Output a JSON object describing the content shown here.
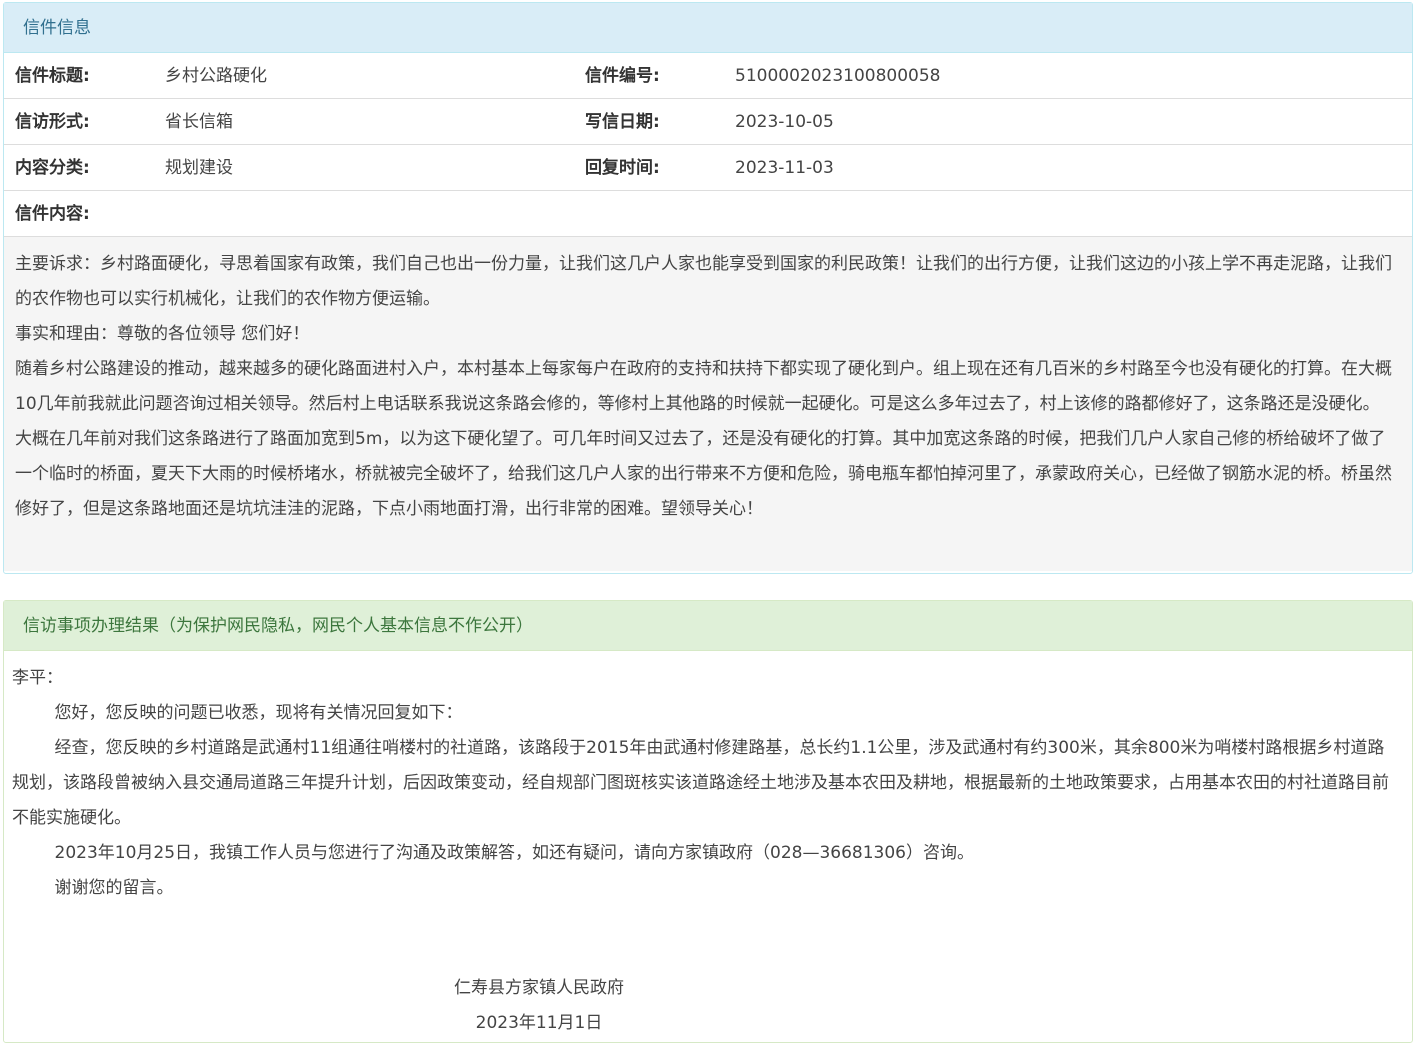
{
  "letter": {
    "heading": "信件信息",
    "rows": [
      {
        "label1": "信件标题:",
        "value1": "乡村公路硬化",
        "label2": "信件编号:",
        "value2": "5100002023100800058"
      },
      {
        "label1": "信访形式:",
        "value1": "省长信箱",
        "label2": "写信日期:",
        "value2": "2023-10-05"
      },
      {
        "label1": "内容分类:",
        "value1": "规划建设",
        "label2": "回复时间:",
        "value2": "2023-11-03"
      }
    ],
    "content_label": "信件内容:",
    "content": [
      "主要诉求：乡村路面硬化，寻思着国家有政策，我们自己也出一份力量，让我们这几户人家也能享受到国家的利民政策！让我们的出行方便，让我们这边的小孩上学不再走泥路，让我们的农作物也可以实行机械化，让我们的农作物方便运输。",
      "事实和理由：尊敬的各位领导 您们好！",
      "随着乡村公路建设的推动，越来越多的硬化路面进村入户，本村基本上每家每户在政府的支持和扶持下都实现了硬化到户。组上现在还有几百米的乡村路至今也没有硬化的打算。在大概10几年前我就此问题咨询过相关领导。然后村上电话联系我说这条路会修的，等修村上其他路的时候就一起硬化。可是这么多年过去了，村上该修的路都修好了，这条路还是没硬化。",
      "大概在几年前对我们这条路进行了路面加宽到5m，以为这下硬化望了。可几年时间又过去了，还是没有硬化的打算。其中加宽这条路的时候，把我们几户人家自己修的桥给破坏了做了一个临时的桥面，夏天下大雨的时候桥堵水，桥就被完全破坏了，给我们这几户人家的出行带来不方便和危险，骑电瓶车都怕掉河里了，承蒙政府关心，已经做了钢筋水泥的桥。桥虽然修好了，但是这条路地面还是坑坑洼洼的泥路，下点小雨地面打滑，出行非常的困难。望领导关心！"
    ]
  },
  "result": {
    "heading": "信访事项办理结果（为保护网民隐私，网民个人基本信息不作公开）",
    "salutation": "李平：",
    "paragraphs": [
      "您好，您反映的问题已收悉，现将有关情况回复如下：",
      "经查，您反映的乡村道路是武通村11组通往哨楼村的社道路，该路段于2015年由武通村修建路基，总长约1.1公里，涉及武通村有约300米，其余800米为哨楼村路根据乡村道路规划，该路段曾被纳入县交通局道路三年提升计划，后因政策变动，经自规部门图斑核实该道路途经土地涉及基本农田及耕地，根据最新的土地政策要求，占用基本农田的村社道路目前不能实施硬化。",
      "2023年10月25日，我镇工作人员与您进行了沟通及政策解答，如还有疑问，请向方家镇政府（028—36681306）咨询。",
      "谢谢您的留言。"
    ],
    "sign_org": "仁寿县方家镇人民政府",
    "sign_date": "2023年11月1日"
  }
}
